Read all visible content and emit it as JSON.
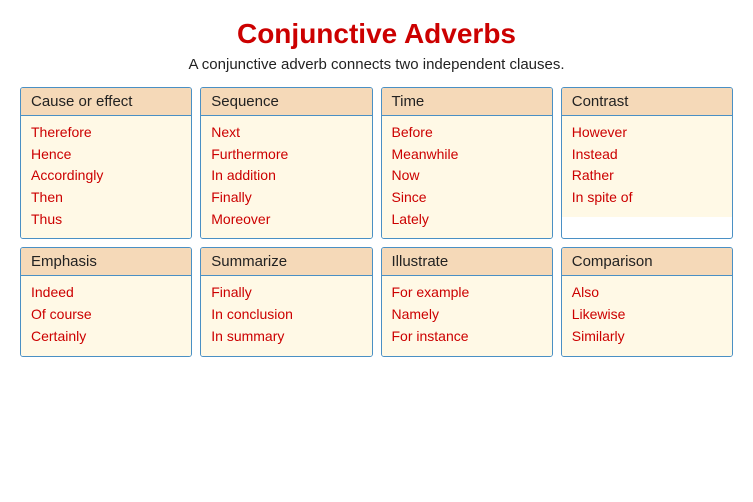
{
  "title": "Conjunctive Adverbs",
  "subtitle": "A conjunctive adverb connects two independent clauses.",
  "cards": [
    {
      "id": "cause-or-effect",
      "header": "Cause or effect",
      "items": [
        "Therefore",
        "Hence",
        "Accordingly",
        "Then",
        "Thus"
      ]
    },
    {
      "id": "sequence",
      "header": "Sequence",
      "items": [
        "Next",
        "Furthermore",
        "In addition",
        "Finally",
        "Moreover"
      ]
    },
    {
      "id": "time",
      "header": "Time",
      "items": [
        "Before",
        "Meanwhile",
        "Now",
        "Since",
        "Lately"
      ]
    },
    {
      "id": "contrast",
      "header": "Contrast",
      "items": [
        "However",
        "Instead",
        "Rather",
        "In spite of"
      ]
    },
    {
      "id": "emphasis",
      "header": "Emphasis",
      "items": [
        "Indeed",
        "Of course",
        "Certainly"
      ]
    },
    {
      "id": "summarize",
      "header": "Summarize",
      "items": [
        "Finally",
        "In conclusion",
        "In summary"
      ]
    },
    {
      "id": "illustrate",
      "header": "Illustrate",
      "items": [
        "For example",
        "Namely",
        "For instance"
      ]
    },
    {
      "id": "comparison",
      "header": "Comparison",
      "items": [
        "Also",
        "Likewise",
        "Similarly"
      ]
    }
  ]
}
